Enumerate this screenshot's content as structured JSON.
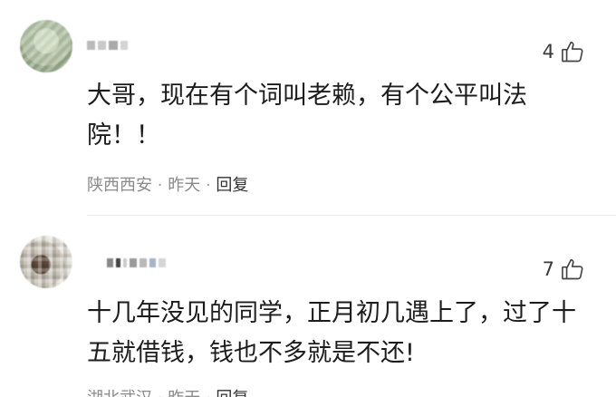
{
  "comments": [
    {
      "likes": "4",
      "text": "大哥，现在有个词叫老赖，有个公平叫法院！！",
      "location": "陕西西安",
      "time": "昨天",
      "reply": "回复"
    },
    {
      "likes": "7",
      "text": "十几年没见的同学，正月初几遇上了，过了十五就借钱，钱也不多就是不还!",
      "location": "湖北武汉",
      "time": "昨天",
      "reply": "回复"
    }
  ],
  "colors": {
    "text": "#1c1c1c",
    "meta": "#8a8a8a",
    "reply": "#333333"
  },
  "icons": {
    "like": "thumbs-up-icon"
  }
}
